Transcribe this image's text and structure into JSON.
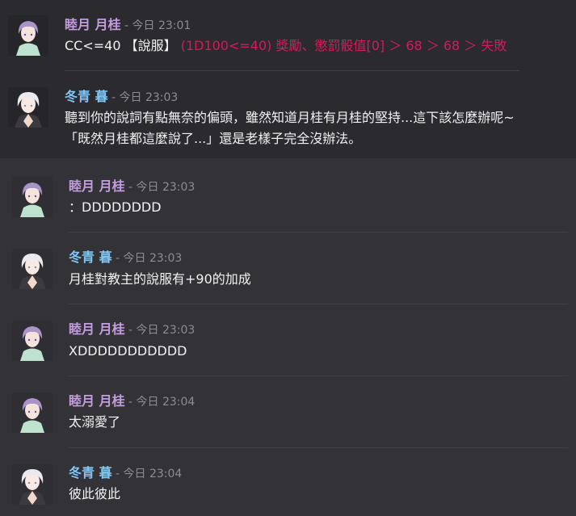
{
  "colors": {
    "background_top": "#2a2a2f",
    "background_bottom": "#323237",
    "name_mutsuki": "#c39ddd",
    "name_fuyu": "#7fc7f4",
    "timestamp": "#8c8c93",
    "dice_text": "#d21d5b",
    "message_text": "#f2f2f2"
  },
  "timestamp_separator": " - ",
  "messages": [
    {
      "author": "睦月 月桂",
      "avatar": "lavender-hair-avatar",
      "time": "今日 23:01",
      "line1": "CC<=40 【說服】",
      "roll": "(1D100<=40) 獎勵、懲罰骰值[0] ＞ 68 ＞ 68 ＞ 失敗"
    },
    {
      "author": "冬青 暮",
      "avatar": "white-hair-avatar",
      "time": "今日 23:03",
      "line1": "聽到你的說詞有點無奈的偏頭，雖然知道月桂有月桂的堅持...這下該怎麼辦呢~",
      "line2": "「既然月桂都這麼說了...」還是老樣子完全沒辦法。"
    },
    {
      "author": "睦月 月桂",
      "avatar": "lavender-hair-avatar",
      "time": "今日 23:03",
      "line1": "：DDDDDDDD"
    },
    {
      "author": "冬青 暮",
      "avatar": "white-hair-avatar",
      "time": "今日 23:03",
      "line1": "月桂對教主的說服有+90的加成"
    },
    {
      "author": "睦月 月桂",
      "avatar": "lavender-hair-avatar",
      "time": "今日 23:03",
      "line1": "XDDDDDDDDDDD"
    },
    {
      "author": "睦月 月桂",
      "avatar": "lavender-hair-avatar",
      "time": "今日 23:04",
      "line1": "太溺愛了"
    },
    {
      "author": "冬青 暮",
      "avatar": "white-hair-avatar",
      "time": "今日 23:04",
      "line1": "彼此彼此"
    }
  ]
}
